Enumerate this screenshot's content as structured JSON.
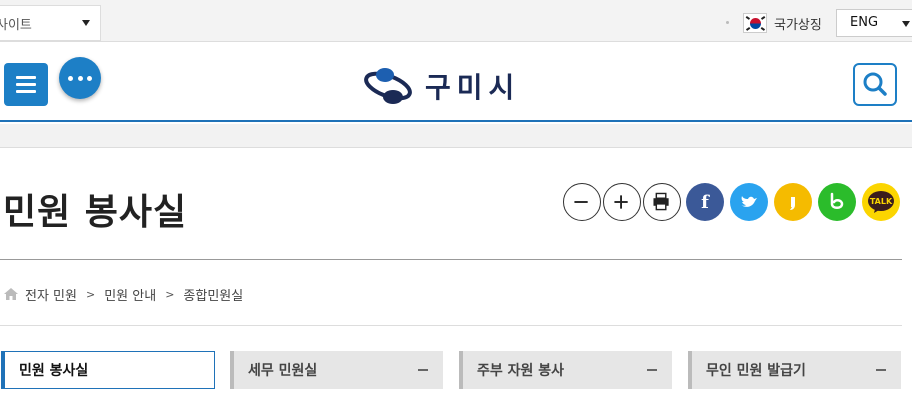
{
  "topbar": {
    "site_select_value": "사이트",
    "national_symbol_label": "국가상징",
    "language_select_value": "ENG"
  },
  "header": {
    "logo_text": "구미시",
    "brand_color": "#1d7fc6"
  },
  "page": {
    "title": "민원 봉사실"
  },
  "tools": [
    {
      "name": "zoom-out",
      "icon": "minus-icon",
      "color": "#ffffff"
    },
    {
      "name": "zoom-in",
      "icon": "plus-icon",
      "color": "#ffffff"
    },
    {
      "name": "print",
      "icon": "printer-icon",
      "color": "#ffffff"
    },
    {
      "name": "facebook",
      "icon": "facebook-icon",
      "color": "#3b5998"
    },
    {
      "name": "twitter",
      "icon": "twitter-icon",
      "color": "#2aa3ef"
    },
    {
      "name": "kakao-story",
      "icon": "kakao-story-icon",
      "color": "#f5bb00"
    },
    {
      "name": "band",
      "icon": "band-icon",
      "color": "#2bbc2b"
    },
    {
      "name": "kakao-talk",
      "icon": "kakao-talk-icon",
      "label": "TALK",
      "color": "#fbd500"
    }
  ],
  "breadcrumb": [
    "전자 민원",
    "민원 안내",
    "종합민원실"
  ],
  "tabs": [
    {
      "label": "민원 봉사실",
      "active": true
    },
    {
      "label": "세무 민원실",
      "active": false
    },
    {
      "label": "주부 자원 봉사",
      "active": false
    },
    {
      "label": "무인 민원 발급기",
      "active": false
    }
  ]
}
